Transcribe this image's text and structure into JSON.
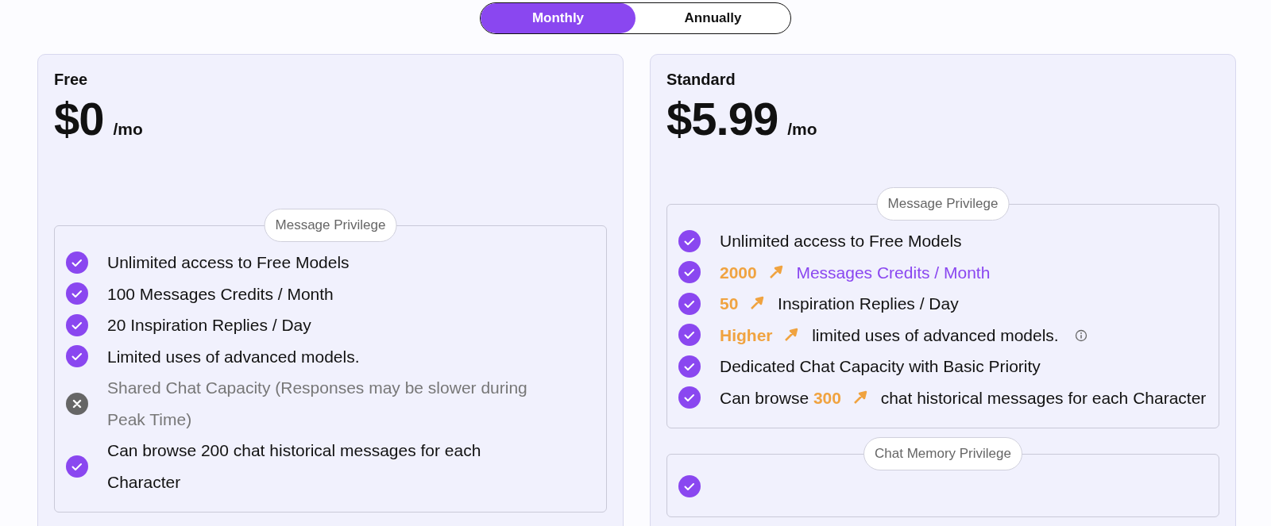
{
  "billing_toggle": [
    {
      "label": "Monthly",
      "selected": true
    },
    {
      "label": "Annually",
      "selected": false
    }
  ],
  "plans": [
    {
      "name": "Free",
      "price": "$0",
      "period": "/mo",
      "sections": [
        {
          "title": "Message Privilege",
          "features": [
            {
              "included": true,
              "parts": [
                {
                  "kind": "text",
                  "text": "Unlimited access to Free Models"
                }
              ]
            },
            {
              "included": true,
              "parts": [
                {
                  "kind": "text",
                  "text": "100 Messages Credits / Month"
                }
              ]
            },
            {
              "included": true,
              "parts": [
                {
                  "kind": "text",
                  "text": "20 Inspiration Replies / Day"
                }
              ]
            },
            {
              "included": true,
              "parts": [
                {
                  "kind": "text",
                  "text": "Limited uses of advanced models."
                }
              ]
            },
            {
              "included": false,
              "parts": [
                {
                  "kind": "text",
                  "text": "Shared Chat Capacity (Responses may be slower during Peak Time)"
                }
              ]
            },
            {
              "included": true,
              "parts": [
                {
                  "kind": "text",
                  "text": "Can browse 200 chat historical messages for each Character"
                }
              ]
            }
          ]
        }
      ]
    },
    {
      "name": "Standard",
      "price": "$5.99",
      "period": "/mo",
      "sections": [
        {
          "title": "Message Privilege",
          "features": [
            {
              "included": true,
              "parts": [
                {
                  "kind": "text",
                  "text": "Unlimited access to Free Models"
                }
              ]
            },
            {
              "included": true,
              "parts": [
                {
                  "kind": "upgrade",
                  "text": "2000"
                },
                {
                  "kind": "accent",
                  "text": "Messages Credits / Month"
                }
              ]
            },
            {
              "included": true,
              "parts": [
                {
                  "kind": "upgrade",
                  "text": "50"
                },
                {
                  "kind": "text",
                  "text": "Inspiration Replies / Day"
                }
              ]
            },
            {
              "included": true,
              "info": true,
              "parts": [
                {
                  "kind": "upgrade",
                  "text": "Higher"
                },
                {
                  "kind": "text",
                  "text": "limited uses of advanced models."
                }
              ]
            },
            {
              "included": true,
              "parts": [
                {
                  "kind": "text",
                  "text": "Dedicated Chat Capacity with Basic Priority"
                }
              ]
            },
            {
              "included": true,
              "parts": [
                {
                  "kind": "text",
                  "text": "Can browse"
                },
                {
                  "kind": "upgrade",
                  "text": "300"
                },
                {
                  "kind": "text",
                  "text": "chat historical messages for each"
                },
                {
                  "kind": "text",
                  "text": "Character"
                }
              ]
            }
          ]
        },
        {
          "title": "Chat Memory Privilege",
          "features": [
            {
              "included": true
            }
          ]
        }
      ]
    }
  ]
}
